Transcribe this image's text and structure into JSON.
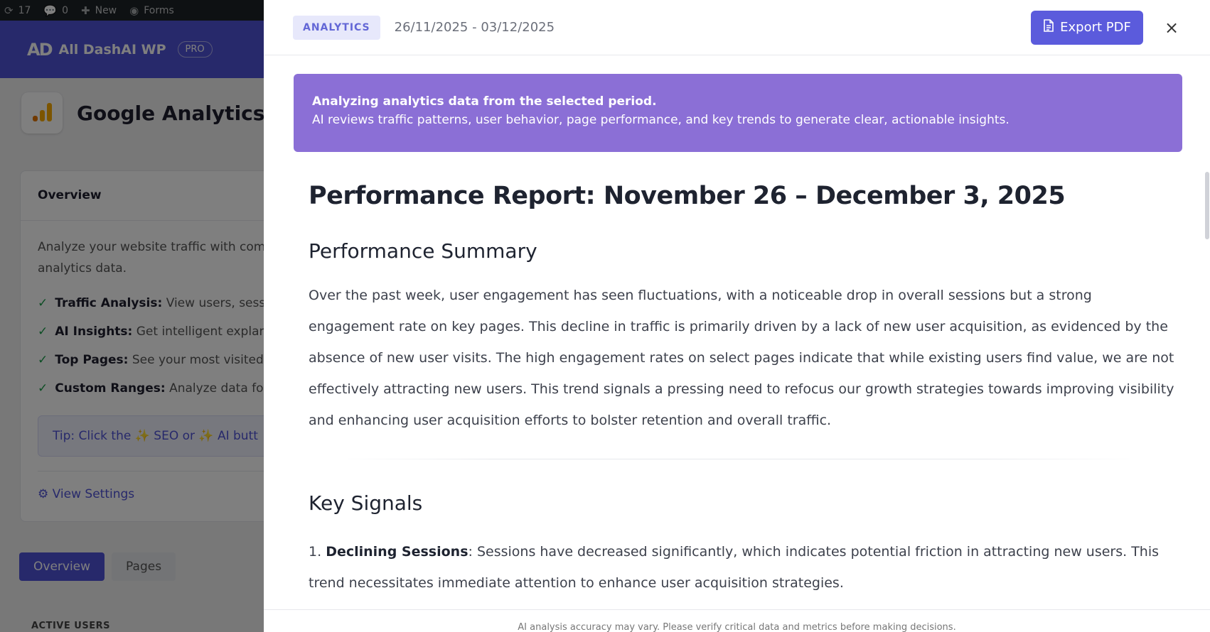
{
  "admin_bar": {
    "updates_count": "17",
    "comments_count": "0",
    "new_label": "New",
    "forms_label": "Forms"
  },
  "plugin": {
    "logo_text": "AD",
    "name": "All DashAI WP",
    "badge": "PRO"
  },
  "page": {
    "title": "Google Analytics"
  },
  "overview": {
    "title": "Overview",
    "desc_line1": "Analyze your website traffic with com",
    "desc_line2": "analytics data.",
    "features": [
      {
        "label": "Traffic Analysis:",
        "text": " View users, sessio"
      },
      {
        "label": "AI Insights:",
        "text": " Get intelligent explana"
      },
      {
        "label": "Top Pages:",
        "text": " See your most visited p"
      },
      {
        "label": "Custom Ranges:",
        "text": " Analyze data for c"
      }
    ],
    "tip": "Tip: Click the ✨ SEO or ✨ AI butt",
    "settings_link": "View Settings"
  },
  "bg_tabs": {
    "overview": "Overview",
    "pages": "Pages"
  },
  "active_users_label": "ACTIVE USERS",
  "panel": {
    "badge": "ANALYTICS",
    "date_range": "26/11/2025 - 03/12/2025",
    "export_label": "Export PDF",
    "close_symbol": "×",
    "notice_title": "Analyzing analytics data from the selected period.",
    "notice_text": "AI reviews traffic patterns, user behavior, page performance, and key trends to generate clear, actionable insights.",
    "report_title": "Performance Report: November 26 – December 3, 2025",
    "summary_heading": "Performance Summary",
    "summary_text": "Over the past week, user engagement has seen fluctuations, with a noticeable drop in overall sessions but a strong engagement rate on key pages. This decline in traffic is primarily driven by a lack of new user acquisition, as evidenced by the absence of new user visits. The high engagement rates on select pages indicate that while existing users find value, we are not effectively attracting new users. This trend signals a pressing need to refocus our growth strategies towards improving visibility and enhancing user acquisition efforts to bolster retention and overall traffic.",
    "signals_heading": "Key Signals",
    "signal_1_number": "1.",
    "signal_1_title": "Declining Sessions",
    "signal_1_text": ": Sessions have decreased significantly, which indicates potential friction in attracting new users. This trend necessitates immediate attention to enhance user acquisition strategies.",
    "footer": "AI analysis accuracy may vary. Please verify critical data and metrics before making decisions."
  }
}
